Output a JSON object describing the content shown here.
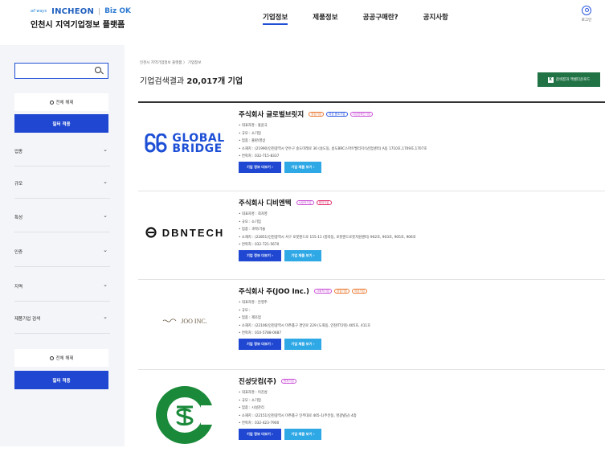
{
  "header": {
    "logo_allways": "all ways",
    "logo_incheon": "INCHEON",
    "logo_bizok": "Biz OK",
    "site_title": "인천시 지역기업정보 플랫폼",
    "nav": [
      "기업정보",
      "제품정보",
      "공공구매란?",
      "공지사항"
    ],
    "login_label": "로그인"
  },
  "sidebar": {
    "search_placeholder": "",
    "reset_label": "전체 해제",
    "apply_label": "필터 적용",
    "filters": [
      "업종",
      "규모",
      "특성",
      "인증",
      "지역",
      "제품기업 검색"
    ],
    "reset_label_bottom": "전체 해제",
    "apply_label_bottom": "필터 적용"
  },
  "main": {
    "breadcrumb": "인천시 지역기업정보 플랫폼  〉  기업정보",
    "result_prefix": "기업검색결과 ",
    "result_count": "20,017개 기업",
    "excel_label": "검색결과 엑셀다운로드",
    "excel_icon": "X",
    "btn_info_label": "기업 정보 더보기 ›",
    "btn_prod_label": "기업 제품 보기 ›"
  },
  "companies": [
    {
      "name": "주식회사 글로벌브릿지",
      "tags": [
        {
          "label": "창업기업",
          "color": "#e8772e"
        },
        {
          "label": "여성 중소기업",
          "color": "#2b58e0"
        },
        {
          "label": "여성장애인기업",
          "color": "#c94bd6"
        }
      ],
      "info": [
        "• 대표자명 : 홍윤국",
        "• 규모 : 소기업",
        "• 업종 : 출판/영상",
        "• 소재지 : (21990)인천광역시 연수구 송도미래로 30 (송도동, 송도BRC스마트밸리지식산업센터) A동 1710호,1709호,1707호",
        "• 연락처 : 032-715-8337"
      ],
      "logo": {
        "word1": "GLOBAL",
        "word2": "BRIDGE",
        "color": "#1d4fd6"
      }
    },
    {
      "name": "주식회사 디비엔텍",
      "tags": [
        {
          "label": "사회적기업",
          "color": "#c94bd6"
        },
        {
          "label": "벤처기업",
          "color": "#e02b6b"
        }
      ],
      "info": [
        "• 대표자명 : 최자영",
        "• 규모 : 소기업",
        "• 업종 : 과학/기술",
        "• 소재지 : (22851)인천광역시 서구 로봇랜드로 155-11 (청라동, 로봇랜드로봇지원센터) 902호, 903호, 905호, 906호",
        "• 연락처 : 032-721-5670"
      ],
      "logo": {
        "word1": "DBNTECH"
      }
    },
    {
      "name": "주식회사 주(JOO Inc.)",
      "tags": [
        {
          "label": "사회적기업",
          "color": "#c94bd6"
        },
        {
          "label": "창업기업",
          "color": "#e8772e"
        },
        {
          "label": "여성기업",
          "color": "#e8772e"
        }
      ],
      "info": [
        "• 대표자명 : 안영주",
        "• 규모 :",
        "• 업종 : 제조업",
        "• 소재지 : (22106)인천광역시 미추홀구 경인로 229 (도화동, 인천IT타워) 405호, 411호",
        "• 연락처 : 010-5788-0687"
      ],
      "logo": {
        "word1": "JOO INC."
      }
    },
    {
      "name": "진성닷컴(주)",
      "tags": [
        {
          "label": "벤처기업",
          "color": "#c94bd6"
        }
      ],
      "info": [
        "• 대표자명 : 이진성",
        "• 규모 : 소기업",
        "• 업종 : 시설관리",
        "• 소재지 : (22151)인천광역시 미추홀구 인주대로 405-1(주안동, 명광빌딩) 4층",
        "• 연락처 : 032-423-7900"
      ],
      "logo": {
        "color": "#1a8a3a"
      }
    }
  ],
  "colors": {
    "primary": "#1f47d1",
    "secondary": "#2fa8e6",
    "excel": "#217346",
    "sidebar_bg": "#f3f5f8"
  }
}
